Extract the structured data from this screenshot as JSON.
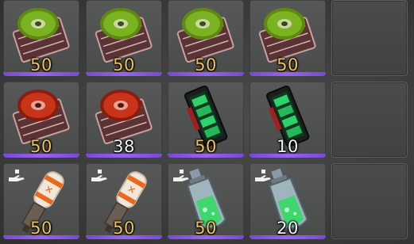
{
  "inventory": {
    "slots": [
      {
        "item_icon": "green-disc-gear-icon",
        "quantity": "50",
        "quantity_color": "#f1c15a",
        "has_hand_icon": false
      },
      {
        "item_icon": "green-disc-gear-icon",
        "quantity": "50",
        "quantity_color": "#f1c15a",
        "has_hand_icon": false
      },
      {
        "item_icon": "green-disc-gear-icon",
        "quantity": "50",
        "quantity_color": "#f1c15a",
        "has_hand_icon": false
      },
      {
        "item_icon": "green-disc-gear-icon",
        "quantity": "50",
        "quantity_color": "#f1c15a",
        "has_hand_icon": false
      },
      {
        "item_icon": "red-disc-gear-icon",
        "quantity": "50",
        "quantity_color": "#f1c15a",
        "has_hand_icon": false
      },
      {
        "item_icon": "red-disc-gear-icon",
        "quantity": "38",
        "quantity_color": "#f3f3f3",
        "has_hand_icon": false
      },
      {
        "item_icon": "green-battery-icon",
        "quantity": "50",
        "quantity_color": "#f1c15a",
        "has_hand_icon": false
      },
      {
        "item_icon": "green-battery-icon",
        "quantity": "10",
        "quantity_color": "#f3f3f3",
        "has_hand_icon": false
      },
      {
        "item_icon": "orange-canister-icon",
        "quantity": "50",
        "quantity_color": "#f1c15a",
        "has_hand_icon": true
      },
      {
        "item_icon": "orange-canister-icon",
        "quantity": "50",
        "quantity_color": "#f1c15a",
        "has_hand_icon": true
      },
      {
        "item_icon": "green-vial-icon",
        "quantity": "50",
        "quantity_color": "#f1c15a",
        "has_hand_icon": true
      },
      {
        "item_icon": "green-vial-icon",
        "quantity": "20",
        "quantity_color": "#f3f3f3",
        "has_hand_icon": true
      }
    ],
    "empty_slots": 3,
    "rarity_bar_color": "#8a55e8"
  }
}
